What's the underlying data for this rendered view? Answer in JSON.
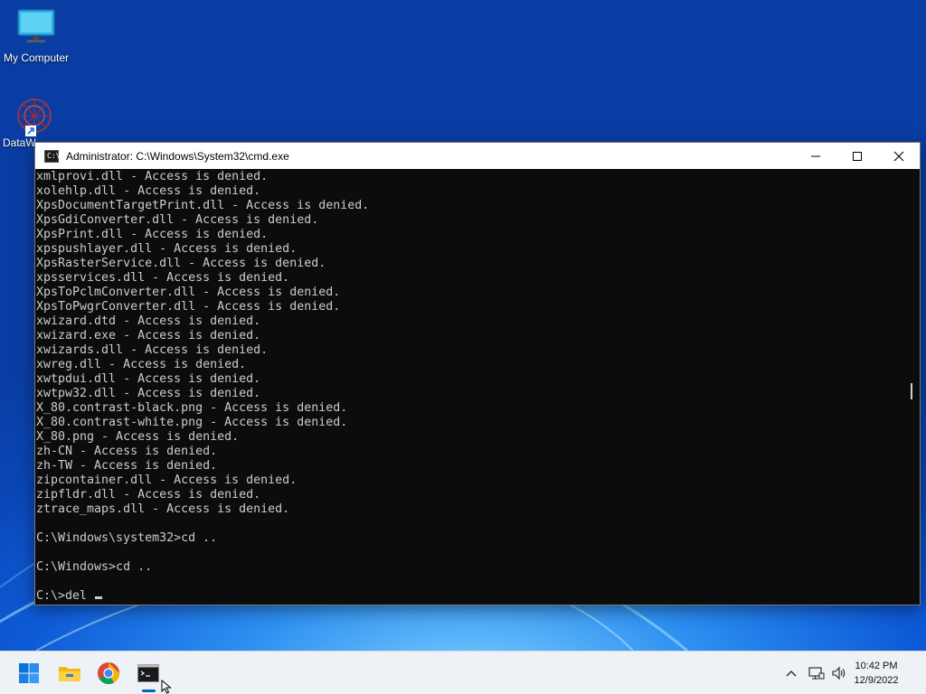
{
  "desktop": {
    "icons": [
      {
        "label": "My Computer"
      },
      {
        "label": "DataW"
      }
    ]
  },
  "window": {
    "title": "Administrator:  C:\\Windows\\System32\\cmd.exe",
    "icon_label": "C:\\",
    "controls": [
      "minimize-icon",
      "maximize-icon",
      "close-icon"
    ]
  },
  "console": {
    "lines": [
      "xmlprovi.dll - Access is denied.",
      "xolehlp.dll - Access is denied.",
      "XpsDocumentTargetPrint.dll - Access is denied.",
      "XpsGdiConverter.dll - Access is denied.",
      "XpsPrint.dll - Access is denied.",
      "xpspushlayer.dll - Access is denied.",
      "XpsRasterService.dll - Access is denied.",
      "xpsservices.dll - Access is denied.",
      "XpsToPclmConverter.dll - Access is denied.",
      "XpsToPwgrConverter.dll - Access is denied.",
      "xwizard.dtd - Access is denied.",
      "xwizard.exe - Access is denied.",
      "xwizards.dll - Access is denied.",
      "xwreg.dll - Access is denied.",
      "xwtpdui.dll - Access is denied.",
      "xwtpw32.dll - Access is denied.",
      "X_80.contrast-black.png - Access is denied.",
      "X_80.contrast-white.png - Access is denied.",
      "X_80.png - Access is denied.",
      "zh-CN - Access is denied.",
      "zh-TW - Access is denied.",
      "zipcontainer.dll - Access is denied.",
      "zipfldr.dll - Access is denied.",
      "ztrace_maps.dll - Access is denied.",
      "",
      "C:\\Windows\\system32>cd ..",
      "",
      "C:\\Windows>cd ..",
      ""
    ],
    "prompt": "C:\\>del "
  },
  "taskbar": {
    "apps": [
      "start-icon",
      "file-explorer-icon",
      "chrome-icon",
      "cmd-icon"
    ],
    "tray": [
      "chevron-up-icon",
      "network-icon",
      "volume-icon"
    ],
    "time": "10:42 PM",
    "date": "12/9/2022"
  },
  "colors": {
    "console_bg": "#0c0c0c",
    "console_fg": "#cccccc",
    "accent": "#0067c0"
  }
}
